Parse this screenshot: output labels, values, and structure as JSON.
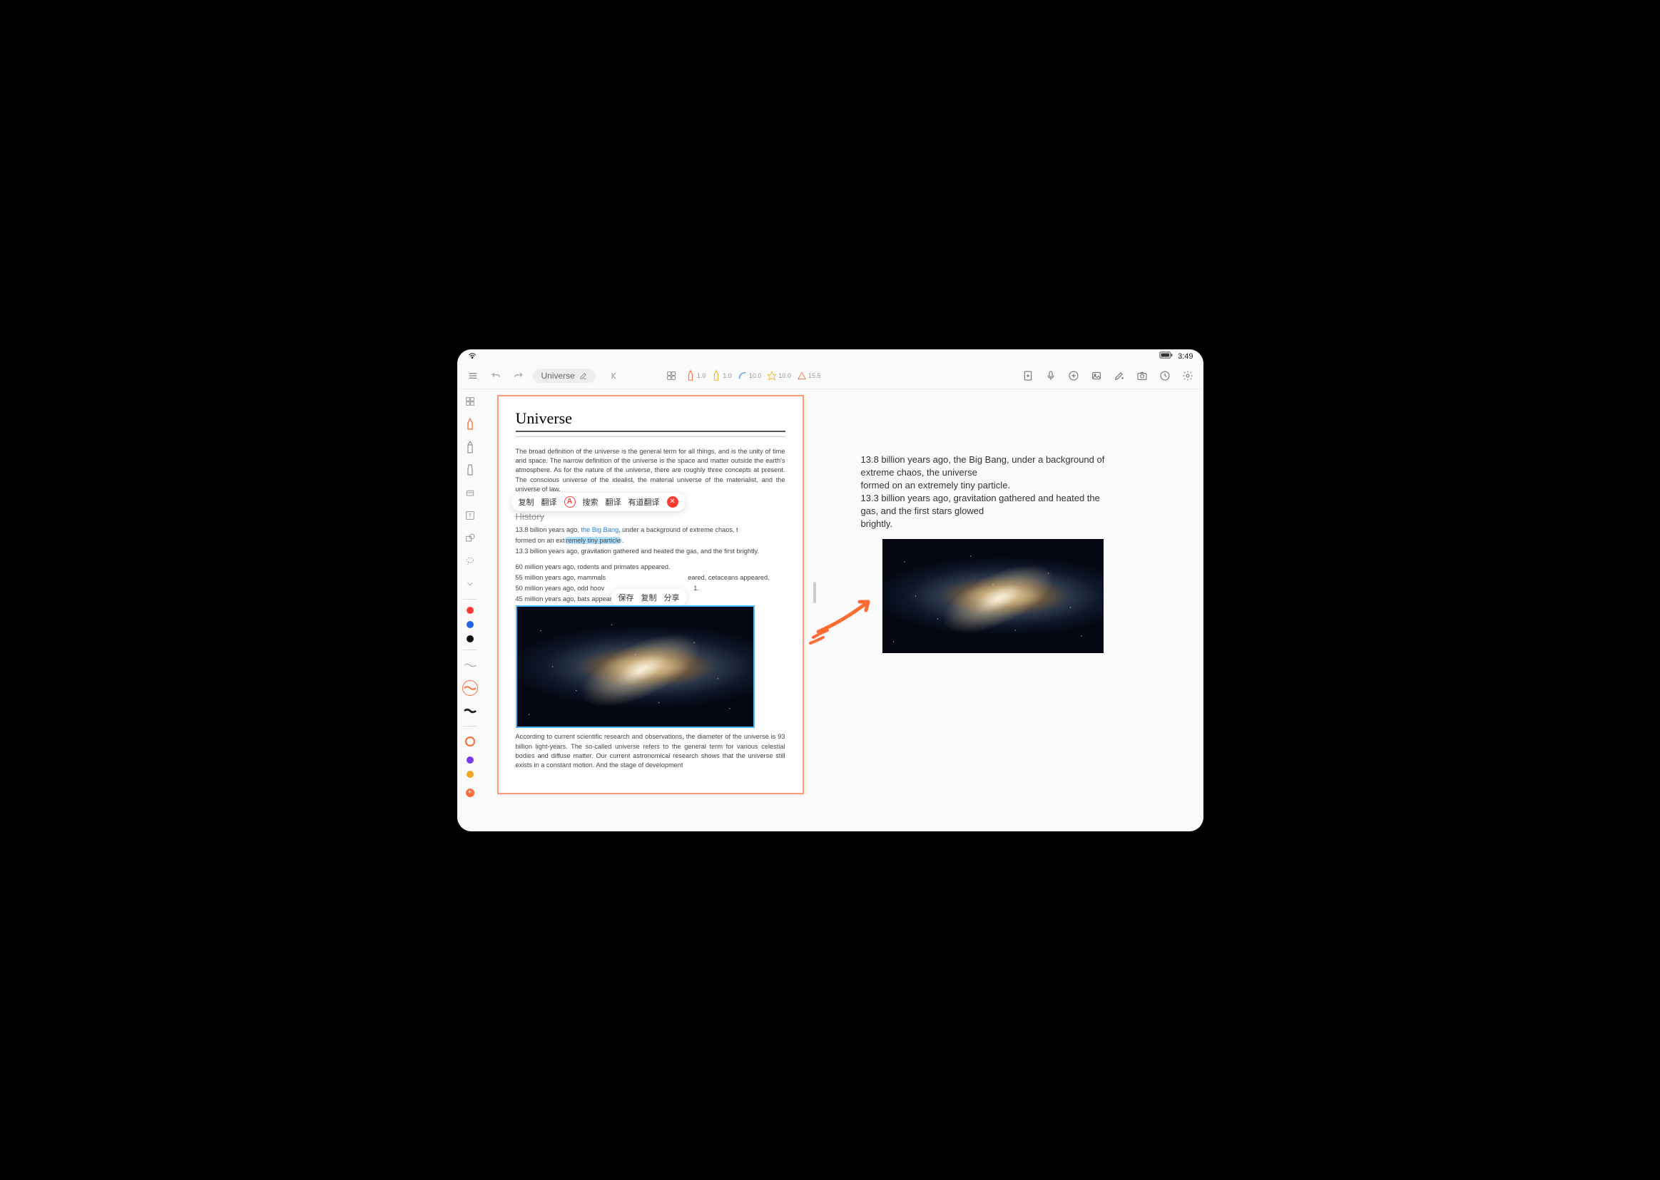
{
  "statusbar": {
    "time": "3:49"
  },
  "toolbar": {
    "doc_title": "Universe",
    "tool_values": {
      "pen1": "1.0",
      "pen2": "1.0",
      "curve": "10.0",
      "star": "10.0",
      "triangle": "15.5"
    }
  },
  "sidebar": {},
  "document": {
    "title": "Universe",
    "intro": "The broad definition of the universe is the general term for all things, and is the unity of time and space. The narrow definition of the universe is the space and matter outside the earth's atmosphere. As for the nature of the universe, there are roughly three concepts at present. The conscious universe of the idealist, the material universe of the materialist, and the universe of law.",
    "history_header": "History",
    "timeline": {
      "l1a": "13.8 billion years ago, ",
      "l1_link": "the Big Bang",
      "l1b": ", under a background of extreme chaos, t",
      "l2a": "formed on an ext",
      "l2_hl": "remely tiny particle",
      "l2b": ".",
      "l3": "13.3 billion years ago, gravitation gathered and heated the gas, and the first brightly.",
      "l4": "60 million years ago, rodents and primates appeared.",
      "l5a": "55 million years ago, mammals",
      "l5b": "eared, cetaceans appeared.",
      "l6a": "50 million years ago, odd hoov",
      "l6b": "1.",
      "l7": "45 million years ago, bats appeared."
    },
    "closing": "According to current scientific research and observations, the diameter of the universe is 93 billion light-years. The so-called universe refers to the general term for various celestial bodies and diffuse matter. Our current astronomical research shows that the universe still exists in a constant motion. And the stage of development"
  },
  "context_menu": {
    "copy": "复制",
    "translate": "翻译",
    "search": "搜索",
    "translate2": "翻译",
    "youdao": "有道翻译"
  },
  "image_menu": {
    "save": "保存",
    "copy": "复制",
    "share": "分享"
  },
  "right_panel": {
    "p1": "13.8 billion years ago, the Big Bang, under a background of extreme chaos, the universe",
    "p2": "formed on an extremely tiny particle.",
    "p3": "13.3 billion years ago, gravitation gathered and heated the gas, and the first stars glowed",
    "p4": "brightly."
  }
}
